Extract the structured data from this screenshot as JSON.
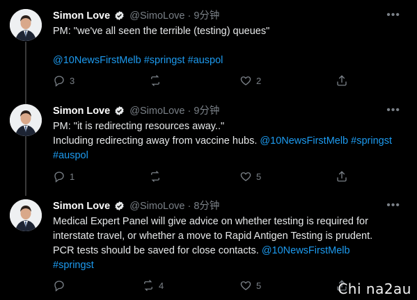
{
  "tweets": [
    {
      "name": "Simon Love",
      "handle": "@SimoLove",
      "separator": "·",
      "time": "9分钟",
      "lines": [
        {
          "text": "PM: \"we've all seen the terrible (testing) queues\""
        },
        {
          "text": ""
        },
        {
          "hashtags": "@10NewsFirstMelb #springst #auspol"
        }
      ],
      "reply_count": "3",
      "retweet_count": "",
      "like_count": "2"
    },
    {
      "name": "Simon Love",
      "handle": "@SimoLove",
      "separator": "·",
      "time": "9分钟",
      "lines": [
        {
          "text": "PM: \"it is redirecting resources away..\""
        },
        {
          "text": "Including redirecting away from vaccine hubs. ",
          "hashtags": "@10NewsFirstMelb #springst"
        },
        {
          "hashtags": "#auspol"
        }
      ],
      "reply_count": "1",
      "retweet_count": "",
      "like_count": "5"
    },
    {
      "name": "Simon Love",
      "handle": "@SimoLove",
      "separator": "·",
      "time": "8分钟",
      "lines": [
        {
          "text": "Medical Expert Panel will give advice on whether testing is required for"
        },
        {
          "text": "interstate travel, or whether a move to Rapid Antigen Testing is prudent."
        },
        {
          "text": "PCR tests should be saved for close contacts. ",
          "hashtags": "@10NewsFirstMelb"
        },
        {
          "hashtags": "#springst"
        }
      ],
      "reply_count": "",
      "retweet_count": "4",
      "like_count": "5"
    }
  ],
  "watermark": "Chi na2au",
  "colors": {
    "link": "#1d9bf0",
    "verified": "#e7e9ea",
    "muted": "#7a8087"
  }
}
